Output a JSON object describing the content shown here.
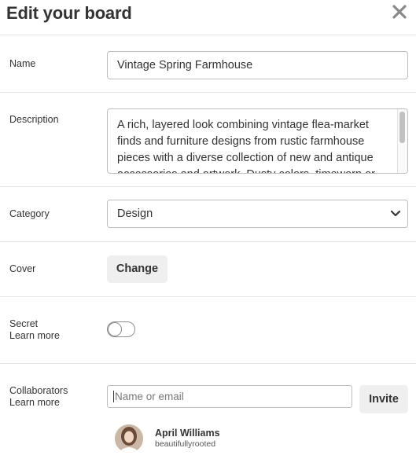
{
  "header": {
    "title": "Edit your board",
    "close_icon": "close-icon"
  },
  "name": {
    "label": "Name",
    "value": "Vintage Spring Farmhouse"
  },
  "description": {
    "label": "Description",
    "value_lines": [
      "A rich, layered look combining vintage flea-market",
      "finds and furniture designs from rustic farmhouse",
      "pieces with a diverse collection of new and antique",
      "accessories and artwork. Dusty colors, timeworn or"
    ]
  },
  "category": {
    "label": "Category",
    "selected": "Design",
    "icon": "chevron-down-icon"
  },
  "cover": {
    "label": "Cover",
    "button_label": "Change"
  },
  "secret": {
    "label": "Secret",
    "learn_more": "Learn more",
    "enabled": false
  },
  "collaborators": {
    "label": "Collaborators",
    "learn_more": "Learn more",
    "input_placeholder": "Name or email",
    "invite_label": "Invite",
    "list": [
      {
        "name": "April Williams",
        "handle": "beautifullyrooted"
      }
    ]
  }
}
